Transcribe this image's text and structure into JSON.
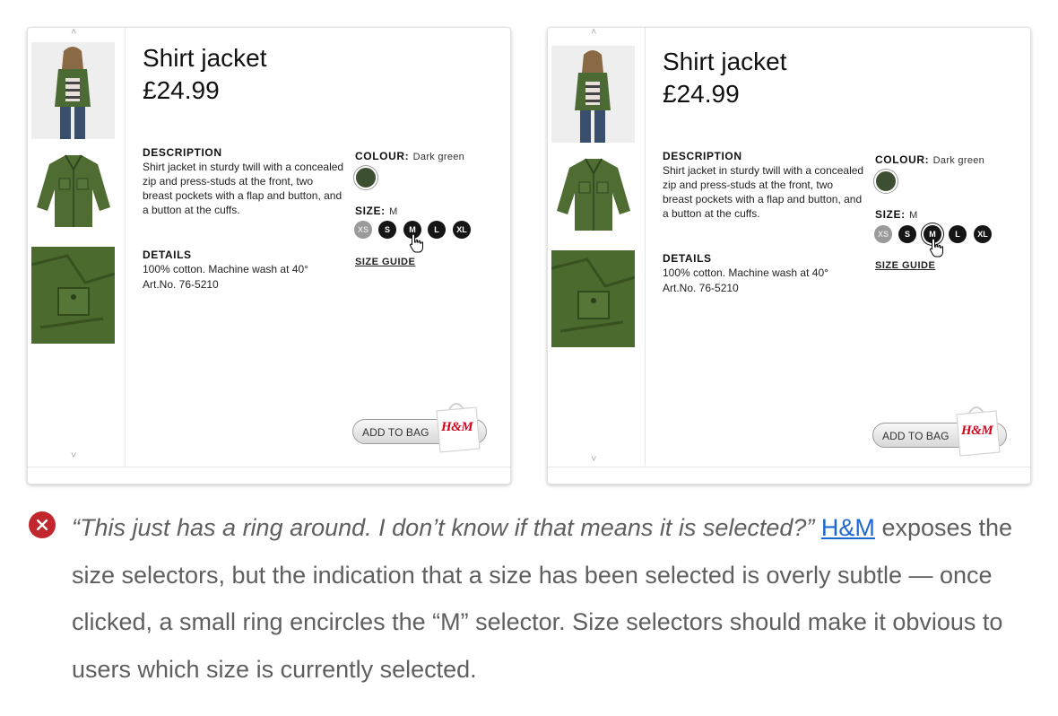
{
  "screens": [
    {
      "id": "before",
      "product": {
        "title": "Shirt jacket",
        "price": "£24.99",
        "description_label": "DESCRIPTION",
        "description": "Shirt jacket in sturdy twill with a concealed zip and press-studs at the front, two breast pockets with a flap and button, and a button at the cuffs.",
        "details_label": "DETAILS",
        "details_line1": "100% cotton. Machine wash at 40°",
        "details_line2": "Art.No. 76-5210",
        "colour_label": "COLOUR:",
        "colour_value": "Dark green",
        "size_label": "SIZE:",
        "size_value": "M",
        "sizes": [
          "XS",
          "S",
          "M",
          "L",
          "XL"
        ],
        "size_guide": "SIZE GUIDE",
        "add_to_bag": "ADD TO BAG",
        "bag_logo": "H&M"
      }
    },
    {
      "id": "after",
      "product": {
        "title": "Shirt jacket",
        "price": "£24.99",
        "description_label": "DESCRIPTION",
        "description": "Shirt jacket in sturdy twill with a concealed zip and press-studs at the front, two breast pockets with a flap and button, and a button at the cuffs.",
        "details_label": "DETAILS",
        "details_line1": "100% cotton. Machine wash at 40°",
        "details_line2": "Art.No. 76-5210",
        "colour_label": "COLOUR:",
        "colour_value": "Dark green",
        "size_label": "SIZE:",
        "size_value": "M",
        "sizes": [
          "XS",
          "S",
          "M",
          "L",
          "XL"
        ],
        "size_guide": "SIZE GUIDE",
        "add_to_bag": "ADD TO BAG",
        "bag_logo": "H&M"
      }
    }
  ],
  "caption": {
    "icon": "error-x-icon",
    "quote": "“This just has a ring around. I don’t know if that means it is selected?”",
    "link_text": "H&M",
    "body": "exposes the size selectors, but the indication that a size has been selected is overly subtle — once clicked, a small ring encircles the “M” selector. Size selectors should make it obvious to users which size is currently selected."
  },
  "colors": {
    "swatch_dark_green": "#3d4f31",
    "error_red": "#c1272d",
    "link_blue": "#1f67d1",
    "brand_red": "#d0021b"
  }
}
